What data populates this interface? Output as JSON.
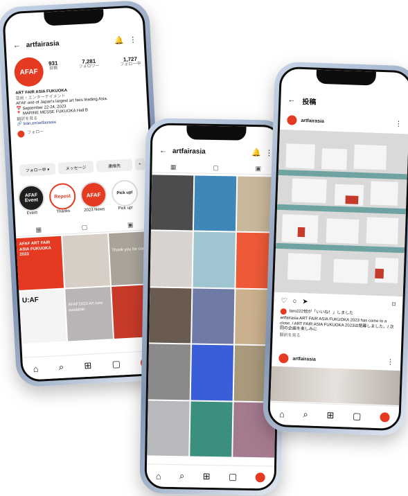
{
  "left": {
    "username": "artfairasia",
    "avatar_text": "AFAF",
    "stats": [
      {
        "num": "931",
        "label": "投稿"
      },
      {
        "num": "7,281",
        "label": "フォロワー"
      },
      {
        "num": "1,727",
        "label": "フォロー中"
      }
    ],
    "bio": [
      "ART FAIR ASIA FUKUOKA",
      "芸術・エンターテイメント",
      "AFAF one of Japan's largest art fairs leading Asia.",
      "📅 September 22-24, 2023",
      "📍 MARINE MESSE FUKUOKA Hall B",
      "翻訳を見る",
      "🔗 lolin.ee/artfairasia"
    ],
    "followed_by": "フォロー",
    "buttons": {
      "follow": "フォロー中 ▾",
      "message": "メッセージ",
      "contact": "連絡先"
    },
    "highlights": [
      {
        "circle": "AFAF Event",
        "label": "Event"
      },
      {
        "circle": "Repost",
        "label": "Thanks"
      },
      {
        "circle": "AFAF",
        "label": "2023 News"
      },
      {
        "circle": "Pick up!",
        "label": "Pick up!"
      }
    ],
    "tiles": [
      {
        "text": "AFAF ART FAIR ASIA FUKUOKA 2023",
        "bg": "#e53a22",
        "fg": "#fff"
      },
      {
        "text": "",
        "bg": "#d7cec6",
        "fg": "#fff"
      },
      {
        "text": "Thank you for coming",
        "bg": "#a9a39a",
        "fg": "#fff"
      },
      {
        "text": "U:AF",
        "bg": "#f4f4f4",
        "fg": "#111"
      },
      {
        "text": "AFAF2023 Art now available",
        "bg": "#b9b5b4",
        "fg": "#fff"
      },
      {
        "text": "",
        "bg": "#c73a2a",
        "fg": "#fff"
      }
    ]
  },
  "middle": {
    "username": "artfairasia",
    "tile_colors": [
      "#4c4c4c",
      "#3f86b9",
      "#c9b79b",
      "#d8d3cf",
      "#9fc5d0",
      "#ee5a38",
      "#6a5b50",
      "#6f7aa6",
      "#cab08d",
      "#8a8a8a",
      "#3a5ed8",
      "#a99a7c",
      "#b7b9bc",
      "#3a8f7f",
      "#a47a8e"
    ]
  },
  "right": {
    "title": "投稿",
    "username": "artfairasia",
    "like_text": "taro222他が「いいね！」しました",
    "caption": "artfairasia ART FAIR ASIA FUKUOKA 2023 has come to a close. / ART FAIR ASIA FUKUOKA 2023は閉幕しました。/ 次回の企画を楽しみに",
    "see_translation": "翻訳を見る",
    "next_username": "artfairasia"
  }
}
